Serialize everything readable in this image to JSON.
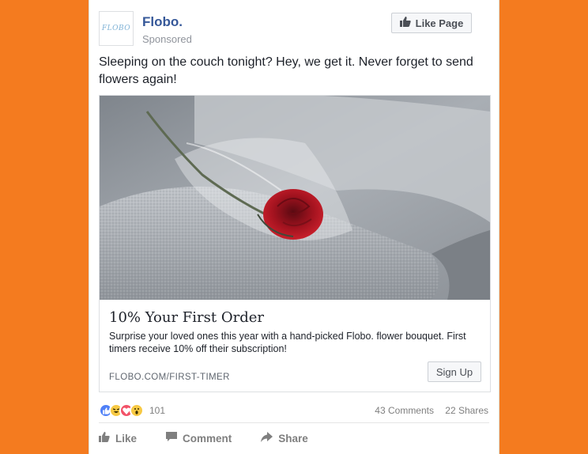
{
  "post": {
    "page_name": "Flobo.",
    "logo_text": "FLOBO",
    "sponsored": "Sponsored",
    "like_page_label": "Like Page",
    "text": "Sleeping on the couch tonight? Hey, we get it. Never forget to send flowers again!"
  },
  "ad": {
    "image_description_icon": "rose-on-couch-photo",
    "title": "10% Your First Order",
    "description": "Surprise your loved ones this year with a hand-picked Flobo. flower bouquet. First timers receive 10% off their subscription!",
    "url": "FLOBO.COM/FIRST-TIMER",
    "cta_label": "Sign Up"
  },
  "stats": {
    "reactions": [
      "like",
      "haha",
      "love",
      "wow"
    ],
    "reaction_count": "101",
    "comments": "43 Comments",
    "shares": "22 Shares"
  },
  "actions": {
    "like": "Like",
    "comment": "Comment",
    "share": "Share"
  },
  "colors": {
    "background": "#f47b1f",
    "link_blue": "#365899",
    "like_blue": "#4f80f7",
    "love_red": "#f25268",
    "haha_yellow": "#f7c944"
  }
}
